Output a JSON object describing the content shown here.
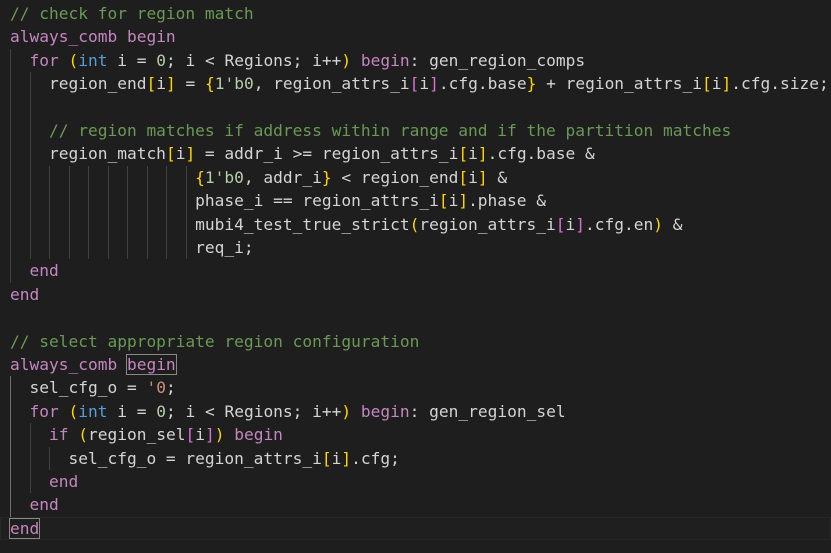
{
  "editor": {
    "colors": {
      "background": "#1e1e1e",
      "comment": "#6a9955",
      "keyword": "#c586c0",
      "keyword2": "#569cd6",
      "identifier": "#d4d4d4",
      "number": "#b5cea8",
      "bracket_level1": "#ffd700",
      "bracket_level2": "#da70d6",
      "bracket_level3": "#179fff",
      "string": "#ce9178"
    },
    "lines": [
      [
        [
          "c",
          "// check for region match"
        ]
      ],
      [
        [
          "k",
          "always_comb"
        ],
        [
          "o",
          " "
        ],
        [
          "k",
          "begin"
        ]
      ],
      [
        [
          "o",
          "  "
        ],
        [
          "k",
          "for"
        ],
        [
          "o",
          " "
        ],
        [
          "p1",
          "("
        ],
        [
          "k2",
          "int"
        ],
        [
          "o",
          " i = "
        ],
        [
          "n",
          "0"
        ],
        [
          "o",
          "; i < Regions; i++"
        ],
        [
          "p1",
          ")"
        ],
        [
          "o",
          " "
        ],
        [
          "k",
          "begin"
        ],
        [
          "o",
          ": gen_region_comps"
        ]
      ],
      [
        [
          "o",
          "    region_end"
        ],
        [
          "p1",
          "["
        ],
        [
          "o",
          "i"
        ],
        [
          "p1",
          "]"
        ],
        [
          "o",
          " = "
        ],
        [
          "p1",
          "{"
        ],
        [
          "n",
          "1'b0"
        ],
        [
          "o",
          ", region_attrs_i"
        ],
        [
          "p2",
          "["
        ],
        [
          "o",
          "i"
        ],
        [
          "p2",
          "]"
        ],
        [
          "o",
          ".cfg.base"
        ],
        [
          "p1",
          "}"
        ],
        [
          "o",
          " + region_attrs_i"
        ],
        [
          "p1",
          "["
        ],
        [
          "o",
          "i"
        ],
        [
          "p1",
          "]"
        ],
        [
          "o",
          ".cfg.size;"
        ]
      ],
      [],
      [
        [
          "o",
          "    "
        ],
        [
          "c",
          "// region matches if address within range and if the partition matches"
        ]
      ],
      [
        [
          "o",
          "    region_match"
        ],
        [
          "p1",
          "["
        ],
        [
          "o",
          "i"
        ],
        [
          "p1",
          "]"
        ],
        [
          "o",
          " = addr_i >= region_attrs_i"
        ],
        [
          "p1",
          "["
        ],
        [
          "o",
          "i"
        ],
        [
          "p1",
          "]"
        ],
        [
          "o",
          ".cfg.base &"
        ]
      ],
      [
        [
          "o",
          "                   "
        ],
        [
          "p1",
          "{"
        ],
        [
          "n",
          "1'b0"
        ],
        [
          "o",
          ", addr_i"
        ],
        [
          "p1",
          "}"
        ],
        [
          "o",
          " < region_end"
        ],
        [
          "p1",
          "["
        ],
        [
          "o",
          "i"
        ],
        [
          "p1",
          "]"
        ],
        [
          "o",
          " &"
        ]
      ],
      [
        [
          "o",
          "                   phase_i == region_attrs_i"
        ],
        [
          "p1",
          "["
        ],
        [
          "o",
          "i"
        ],
        [
          "p1",
          "]"
        ],
        [
          "o",
          ".phase &"
        ]
      ],
      [
        [
          "o",
          "                   mubi4_test_true_strict"
        ],
        [
          "p1",
          "("
        ],
        [
          "o",
          "region_attrs_i"
        ],
        [
          "p2",
          "["
        ],
        [
          "o",
          "i"
        ],
        [
          "p2",
          "]"
        ],
        [
          "o",
          ".cfg.en"
        ],
        [
          "p1",
          ")"
        ],
        [
          "o",
          " &"
        ]
      ],
      [
        [
          "o",
          "                   req_i;"
        ]
      ],
      [
        [
          "o",
          "  "
        ],
        [
          "k",
          "end"
        ]
      ],
      [
        [
          "k",
          "end"
        ]
      ],
      [],
      [
        [
          "c",
          "// select appropriate region configuration"
        ]
      ],
      [
        [
          "k",
          "always_comb"
        ],
        [
          "o",
          " "
        ],
        [
          "kb",
          "begin"
        ]
      ],
      [
        [
          "o",
          "  sel_cfg_o = "
        ],
        [
          "s",
          "'0"
        ],
        [
          "o",
          ";"
        ]
      ],
      [
        [
          "o",
          "  "
        ],
        [
          "k",
          "for"
        ],
        [
          "o",
          " "
        ],
        [
          "p1",
          "("
        ],
        [
          "k2",
          "int"
        ],
        [
          "o",
          " i = "
        ],
        [
          "n",
          "0"
        ],
        [
          "o",
          "; i < Regions; i++"
        ],
        [
          "p1",
          ")"
        ],
        [
          "o",
          " "
        ],
        [
          "k",
          "begin"
        ],
        [
          "o",
          ": gen_region_sel"
        ]
      ],
      [
        [
          "o",
          "    "
        ],
        [
          "k",
          "if"
        ],
        [
          "o",
          " "
        ],
        [
          "p1",
          "("
        ],
        [
          "o",
          "region_sel"
        ],
        [
          "p2",
          "["
        ],
        [
          "o",
          "i"
        ],
        [
          "p2",
          "]"
        ],
        [
          "p1",
          ")"
        ],
        [
          "o",
          " "
        ],
        [
          "k",
          "begin"
        ]
      ],
      [
        [
          "o",
          "      sel_cfg_o = region_attrs_i"
        ],
        [
          "p1",
          "["
        ],
        [
          "o",
          "i"
        ],
        [
          "p1",
          "]"
        ],
        [
          "o",
          ".cfg;"
        ]
      ],
      [
        [
          "o",
          "    "
        ],
        [
          "k",
          "end"
        ]
      ],
      [
        [
          "o",
          "  "
        ],
        [
          "k",
          "end"
        ]
      ],
      [
        [
          "kb",
          "end"
        ]
      ]
    ]
  }
}
